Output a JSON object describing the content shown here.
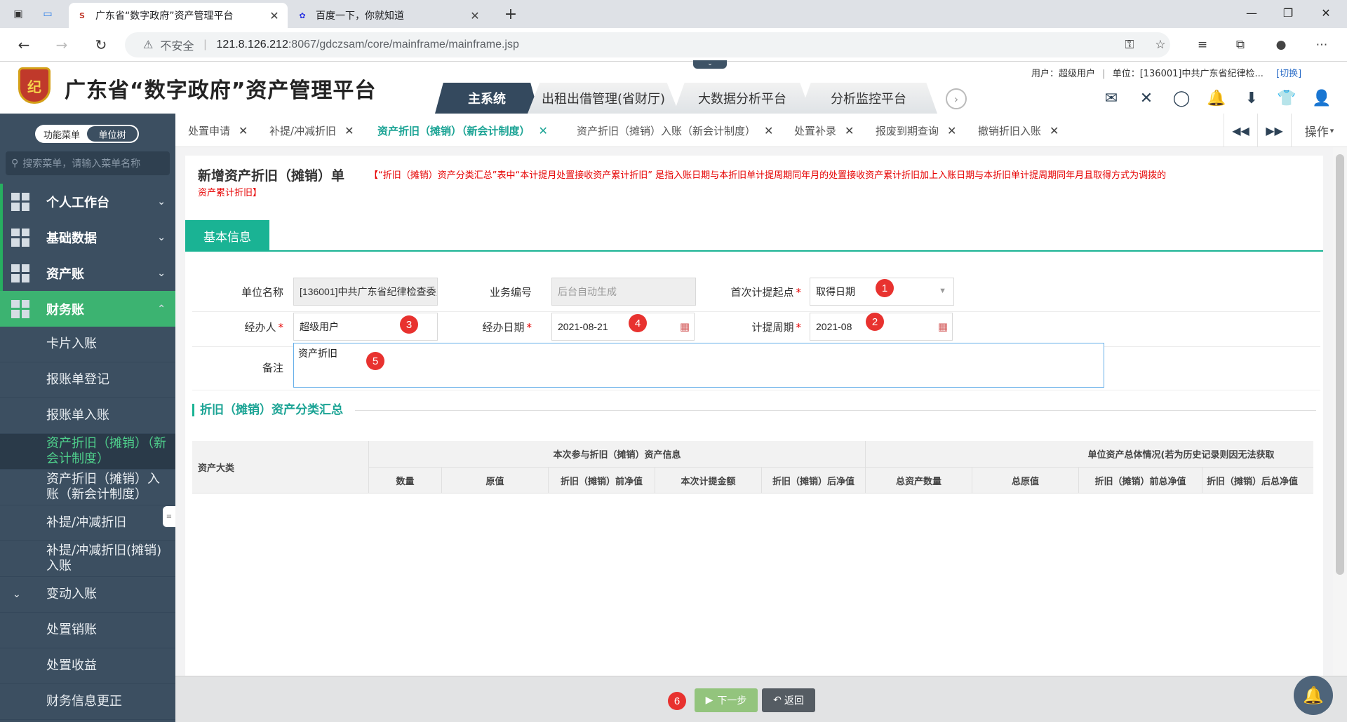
{
  "browser": {
    "tabs": [
      {
        "title": "广东省“数字政府”资产管理平台",
        "active": true
      },
      {
        "title": "百度一下，你就知道",
        "active": false
      }
    ],
    "security": "不安全",
    "url_host": "121.8.126.212",
    "url_path": ":8067/gdczsam/core/mainframe/mainframe.jsp"
  },
  "header": {
    "logo_text": "纪",
    "title": "广东省“数字政府”资产管理平台",
    "user_label": "用户：超级用户",
    "unit_label": "单位：[136001]中共广东省纪律检...",
    "switch_label": "[切换]",
    "system_tabs": [
      "主系统",
      "出租出借管理(省财厅)",
      "大数据分析平台",
      "分析监控平台"
    ]
  },
  "sidebar": {
    "toggle": [
      "功能菜单",
      "单位树"
    ],
    "search_placeholder": "搜索菜单，请输入菜单名称",
    "groups": [
      "个人工作台",
      "基础数据",
      "资产账",
      "财务账"
    ],
    "subitems": [
      "卡片入账",
      "报账单登记",
      "报账单入账",
      "资产折旧（摊销）（新会计制度）",
      "资产折旧（摊销）入账（新会计制度）",
      "补提/冲减折旧",
      "补提/冲减折旧(摊销)入账",
      "变动入账",
      "处置销账",
      "处置收益",
      "财务信息更正"
    ]
  },
  "content_tabs": [
    "处置申请",
    "补提/冲减折旧",
    "资产折旧（摊销）（新会计制度）",
    "资产折旧（摊销）入账（新会计制度）",
    "处置补录",
    "报废到期查询",
    "撤销折旧入账"
  ],
  "content_tabs_op": "操作",
  "form": {
    "title": "新增资产折旧（摊销）单",
    "note": "【“折旧（摊销）资产分类汇总”表中“本计提月处置接收资产累计折旧” 是指入账日期与本折旧单计提周期同年月的处置接收资产累计折旧加上入账日期与本折旧单计提周期同年月且取得方式为调拨的",
    "note_cont": "资产累计折旧】",
    "section_tab": "基本信息",
    "fields": {
      "unit_name_label": "单位名称",
      "unit_name_value": "[136001]中共广东省纪律检查委员会",
      "biz_no_label": "业务编号",
      "biz_no_placeholder": "后台自动生成",
      "first_start_label": "首次计提起点",
      "first_start_value": "取得日期",
      "handler_label": "经办人",
      "handler_value": "超级用户",
      "handle_date_label": "经办日期",
      "handle_date_value": "2021-08-21",
      "period_label": "计提周期",
      "period_value": "2021-08",
      "remark_label": "备注",
      "remark_value": "资产折旧"
    },
    "badges": [
      "1",
      "2",
      "3",
      "4",
      "5",
      "6"
    ],
    "summary_title": "折旧（摊销）资产分类汇总",
    "table": {
      "col_category": "资产大类",
      "group1": "本次参与折旧（摊销）资产信息",
      "group2": "单位资产总体情况(若为历史记录则因无法获取",
      "cols": [
        "数量",
        "原值",
        "折旧（摊销）前净值",
        "本次计提金额",
        "折旧（摊销）后净值",
        "总资产数量",
        "总原值",
        "折旧（摊销）前总净值",
        "折旧（摊销）后总净值"
      ]
    },
    "btn_next": "下一步",
    "btn_back": "返回"
  }
}
